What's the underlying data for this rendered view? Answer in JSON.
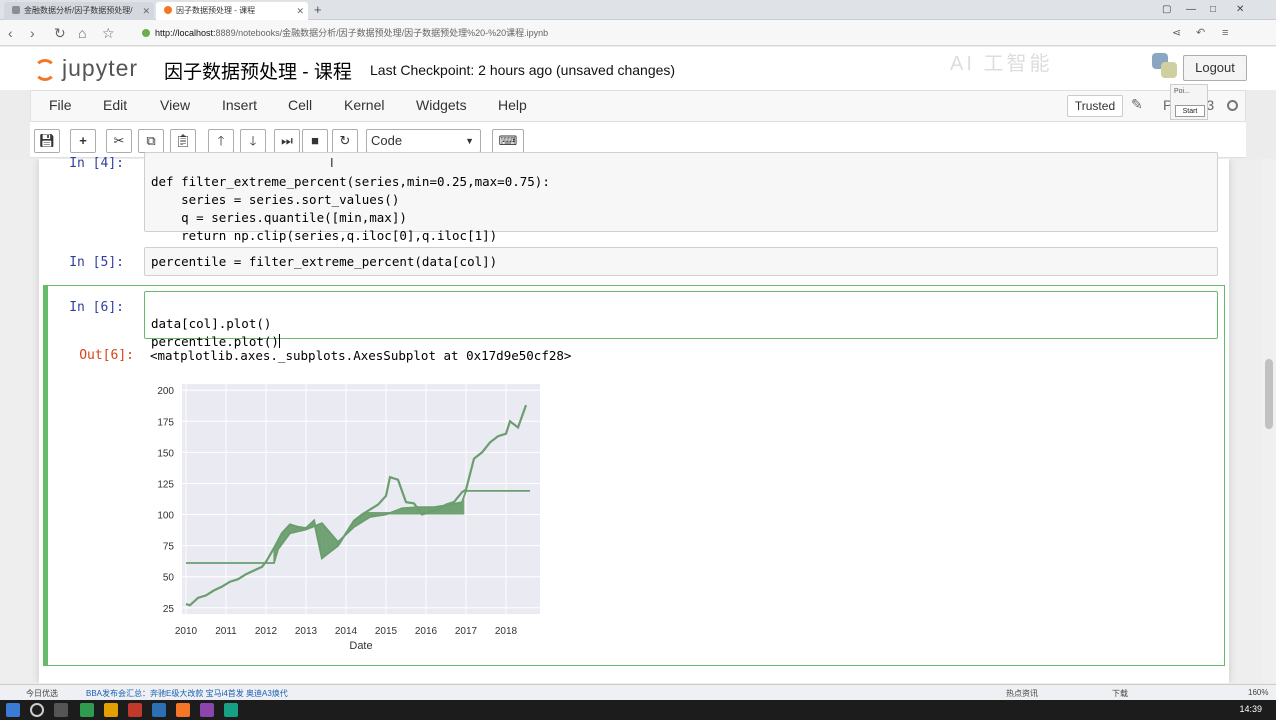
{
  "browser": {
    "tabs": [
      {
        "label": "金融数据分析/因子数据预处理/"
      },
      {
        "label": "因子数据预处理 - 课程"
      }
    ],
    "url_host": "http://localhost:",
    "url_rest": "8889/notebooks/金融数据分析/因子数据预处理/因子数据预处理%20-%20课程.ipynb"
  },
  "header": {
    "logo_text": "jupyter",
    "notebook_title": "因子数据预处理 - 课程",
    "checkpoint": "Last Checkpoint: 2 hours ago (unsaved changes)",
    "logout_label": "Logout"
  },
  "menubar": {
    "items": [
      "File",
      "Edit",
      "View",
      "Insert",
      "Cell",
      "Kernel",
      "Widgets",
      "Help"
    ],
    "trusted_label": "Trusted",
    "kernel_name": "P",
    "kernel_suffix": "3"
  },
  "popup": {
    "text": "Poi...",
    "start_label": "Start"
  },
  "toolbar": {
    "cell_type": "Code"
  },
  "cells": {
    "c4": {
      "prompt": "In [4]:",
      "lines": [
        "def filter_extreme_percent(series,min=0.25,max=0.75):",
        "    series = series.sort_values()",
        "    q = series.quantile([min,max])",
        "    return np.clip(series,q.iloc[0],q.iloc[1])"
      ]
    },
    "c5": {
      "prompt": "In [5]:",
      "line": "percentile = filter_extreme_percent(data[col])"
    },
    "c6": {
      "prompt": "In [6]:",
      "line1": "data[col].plot()",
      "line2": "percentile.plot()",
      "out_prompt": "Out[6]:",
      "out_text": "<matplotlib.axes._subplots.AxesSubplot at 0x17d9e50cf28>"
    }
  },
  "chart_data": {
    "type": "line",
    "xlabel": "Date",
    "ylabel": "",
    "title": "",
    "xlim": [
      2009.9,
      2018.85
    ],
    "ylim": [
      20,
      205
    ],
    "xticks": [
      "2010",
      "2011",
      "2012",
      "2013",
      "2014",
      "2015",
      "2016",
      "2017",
      "2018"
    ],
    "yticks": [
      25,
      50,
      75,
      100,
      125,
      150,
      175,
      200
    ],
    "grid": true,
    "background": "#eaeaf2",
    "color": "#6a9e6e",
    "series": [
      {
        "x": [
          2010.0,
          2010.1,
          2010.3,
          2010.5,
          2010.7,
          2010.9,
          2011.1,
          2011.3,
          2011.5,
          2011.7,
          2011.9,
          2012.0,
          2012.2,
          2012.4,
          2012.6,
          2012.8,
          2013.0,
          2013.2,
          2013.4,
          2013.6,
          2013.8,
          2014.0,
          2014.2,
          2014.4,
          2014.6,
          2014.8,
          2015.0,
          2015.1,
          2015.3,
          2015.5,
          2015.7,
          2015.9,
          2016.1,
          2016.3,
          2016.5,
          2016.7,
          2016.9,
          2017.0,
          2017.2,
          2017.4,
          2017.6,
          2017.8,
          2018.0,
          2018.1,
          2018.3,
          2018.5
        ],
        "y": [
          28,
          27,
          33,
          35,
          39,
          42,
          46,
          48,
          52,
          55,
          58,
          62,
          73,
          85,
          92,
          90,
          89,
          95,
          65,
          70,
          75,
          85,
          95,
          100,
          104,
          108,
          115,
          130,
          128,
          110,
          109,
          100,
          102,
          104,
          108,
          110,
          118,
          120,
          145,
          150,
          158,
          163,
          165,
          175,
          170,
          188
        ]
      },
      {
        "x": [
          2010.0,
          2012.2,
          2012.3,
          2012.6,
          2013.0,
          2013.4,
          2013.8,
          2014.2,
          2014.6,
          2015.0,
          2015.4,
          2015.8,
          2016.2,
          2016.6,
          2016.9,
          2017.0,
          2018.6
        ],
        "y": [
          61,
          61,
          72,
          85,
          88,
          93,
          78,
          90,
          98,
          100,
          105,
          106,
          106,
          108,
          110,
          119,
          119
        ]
      }
    ]
  },
  "status": {
    "left1": "今日优选",
    "left2": "BBA发布会汇总：奔驰E级大改款 宝马i4首发 奥迪A3焕代",
    "right1": "热点资讯",
    "right2": "下载",
    "zoom": "160%"
  },
  "taskbar": {
    "time": "14:39"
  }
}
